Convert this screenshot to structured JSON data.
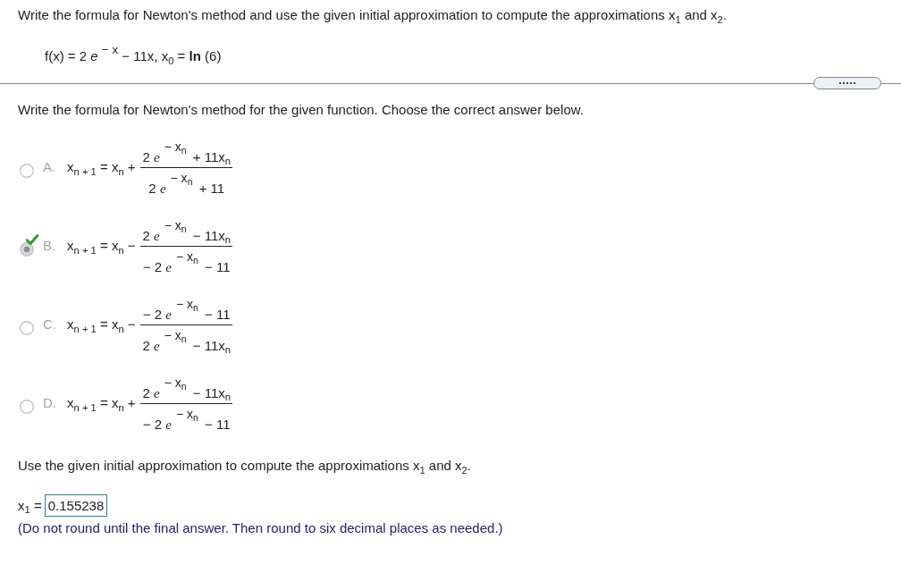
{
  "question": "Write the formula for Newton's method and use the given initial approximation to compute the approximations x$_{1}$ and x$_{2}$.",
  "given": "f(x) = 2 *e* $^{− x}$ − 11x, x$_{0}$ = **ln** (6)",
  "part1": {
    "prompt": "Write the formula for Newton's method for the given function. Choose the correct answer below.",
    "options": [
      {
        "letter": "A.",
        "lhs": "x$_{n + 1}$ = x$_{n}$",
        "operator": "+",
        "numerator": {
          "coefficient": "2",
          "base": "e",
          "exponent": "− x$_{n}$",
          "rest": "+ 11x$_{n}$"
        },
        "denominator": {
          "coefficient": "2",
          "base": "e",
          "exponent": "− x$_{n}$",
          "rest": "+ 11"
        },
        "selected": false,
        "correct": false
      },
      {
        "letter": "B.",
        "lhs": "x$_{n + 1}$ = x$_{n}$",
        "operator": "−",
        "numerator": {
          "coefficient": "2",
          "base": "e",
          "exponent": "− x$_{n}$",
          "rest": "− 11x$_{n}$"
        },
        "denominator": {
          "coefficient": "− 2",
          "base": "e",
          "exponent": "− x$_{n}$",
          "rest": "− 11"
        },
        "selected": true,
        "correct": true
      },
      {
        "letter": "C.",
        "lhs": "x$_{n + 1}$ = x$_{n}$",
        "operator": "−",
        "numerator": {
          "coefficient": "− 2",
          "base": "e",
          "exponent": "− x$_{n}$",
          "rest": "− 11"
        },
        "denominator": {
          "coefficient": "2",
          "base": "e",
          "exponent": "− x$_{n}$",
          "rest": "− 11x$_{n}$"
        },
        "selected": false,
        "correct": false
      },
      {
        "letter": "D.",
        "lhs": "x$_{n + 1}$ = x$_{n}$",
        "operator": "+",
        "numerator": {
          "coefficient": "2",
          "base": "e",
          "exponent": "− x$_{n}$",
          "rest": "− 11x$_{n}$"
        },
        "denominator": {
          "coefficient": "− 2",
          "base": "e",
          "exponent": "− x$_{n}$",
          "rest": "− 11"
        },
        "selected": false,
        "correct": false
      }
    ]
  },
  "part2": {
    "prompt": "Use the given initial approximation to compute the approximations x$_{1}$ and x$_{2}$.",
    "answers": [
      {
        "label": "x$_{1}$ =",
        "value": "0.155238"
      }
    ],
    "note": "(Do not round until the final answer. Then round to six decimal places as needed.)"
  }
}
